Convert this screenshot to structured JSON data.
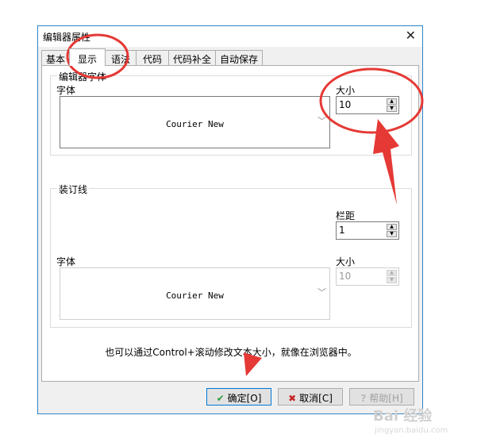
{
  "window": {
    "title": "编辑器属性",
    "close_glyph": "✕"
  },
  "tabs": [
    {
      "label": "基本"
    },
    {
      "label": "显示"
    },
    {
      "label": "语法"
    },
    {
      "label": "代码"
    },
    {
      "label": "代码补全"
    },
    {
      "label": "自动保存"
    }
  ],
  "editor_font": {
    "legend": "编辑器字体",
    "font_label": "字体",
    "font_name": "Courier New",
    "size_label": "大小",
    "size_value": "10"
  },
  "gutter": {
    "legend": "装订线",
    "margin_label": "栏距",
    "margin_value": "1",
    "font_label": "字体",
    "font_name": "Courier New",
    "size_label": "大小",
    "size_value": "10"
  },
  "hint": "也可以通过Control+滚动修改文本大小，就像在浏览器中。",
  "buttons": {
    "ok": "确定[O]",
    "cancel": "取消[C]",
    "help": "帮助[H]"
  },
  "watermark": {
    "main": "Bai 经验",
    "sub": "jingyan.baidu.com"
  },
  "colors": {
    "annotation": "#e53935",
    "accent": "#0078d7"
  }
}
